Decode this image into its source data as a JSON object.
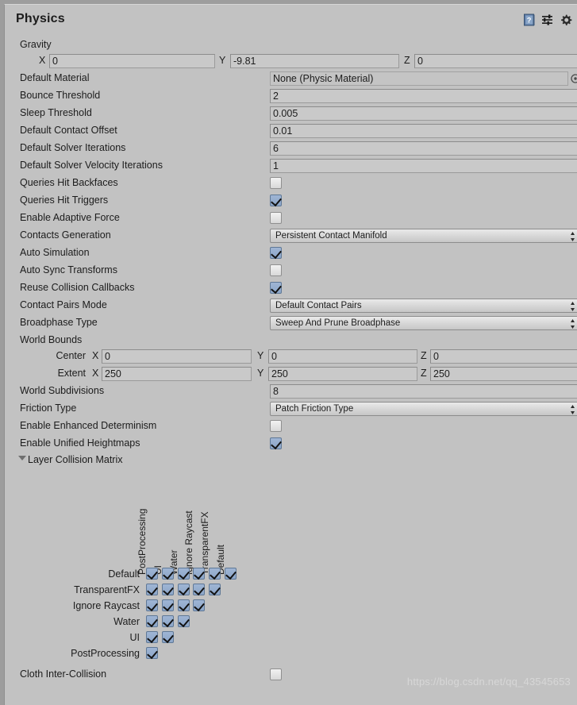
{
  "window": {
    "title": "Physics",
    "header_icons": [
      {
        "name": "help-icon",
        "glyph": "?"
      },
      {
        "name": "preset-icon",
        "glyph": "preset"
      },
      {
        "name": "settings-gear-icon",
        "glyph": "gear"
      }
    ]
  },
  "colors": {
    "panel_background": "#c2c2c2",
    "page_background": "#9d9d9d",
    "field_background": "#c9c9c9",
    "checkbox_checked": "#8ca6c9",
    "text": "#1c1c1c",
    "watermark": "#d9d9d9"
  },
  "properties": {
    "gravity": {
      "label": "Gravity",
      "x_axis_label": "X",
      "x_value": "0",
      "y_axis_label": "Y",
      "y_value": "-9.81",
      "z_axis_label": "Z",
      "z_value": "0"
    },
    "default_material": {
      "label": "Default Material",
      "value": "None (Physic Material)"
    },
    "bounce_threshold": {
      "label": "Bounce Threshold",
      "value": "2"
    },
    "sleep_threshold": {
      "label": "Sleep Threshold",
      "value": "0.005"
    },
    "default_contact_offset": {
      "label": "Default Contact Offset",
      "value": "0.01"
    },
    "default_solver_iterations": {
      "label": "Default Solver Iterations",
      "value": "6"
    },
    "default_solver_velocity_iterations": {
      "label": "Default Solver Velocity Iterations",
      "value": "1"
    },
    "queries_hit_backfaces": {
      "label": "Queries Hit Backfaces",
      "checked": false
    },
    "queries_hit_triggers": {
      "label": "Queries Hit Triggers",
      "checked": true
    },
    "enable_adaptive_force": {
      "label": "Enable Adaptive Force",
      "checked": false
    },
    "contacts_generation": {
      "label": "Contacts Generation",
      "value": "Persistent Contact Manifold"
    },
    "auto_simulation": {
      "label": "Auto Simulation",
      "checked": true
    },
    "auto_sync_transforms": {
      "label": "Auto Sync Transforms",
      "checked": false
    },
    "reuse_collision_callbacks": {
      "label": "Reuse Collision Callbacks",
      "checked": true
    },
    "contact_pairs_mode": {
      "label": "Contact Pairs Mode",
      "value": "Default Contact Pairs"
    },
    "broadphase_type": {
      "label": "Broadphase Type",
      "value": "Sweep And Prune Broadphase"
    },
    "world_bounds": {
      "label": "World Bounds",
      "center": {
        "label": "Center",
        "x_axis_label": "X",
        "x_value": "0",
        "y_axis_label": "Y",
        "y_value": "0",
        "z_axis_label": "Z",
        "z_value": "0"
      },
      "extent": {
        "label": "Extent",
        "x_axis_label": "X",
        "x_value": "250",
        "y_axis_label": "Y",
        "y_value": "250",
        "z_axis_label": "Z",
        "z_value": "250"
      }
    },
    "world_subdivisions": {
      "label": "World Subdivisions",
      "value": "8"
    },
    "friction_type": {
      "label": "Friction Type",
      "value": "Patch Friction Type"
    },
    "enable_enhanced_determinism": {
      "label": "Enable Enhanced Determinism",
      "checked": false
    },
    "enable_unified_heightmaps": {
      "label": "Enable Unified Heightmaps",
      "checked": true
    },
    "cloth_inter_collision": {
      "label": "Cloth Inter-Collision",
      "checked": false
    }
  },
  "layer_collision_matrix": {
    "label": "Layer Collision Matrix",
    "expanded": true,
    "column_labels": [
      "PostProcessing",
      "UI",
      "Water",
      "Ignore Raycast",
      "TransparentFX",
      "Default"
    ],
    "row_labels": [
      "Default",
      "TransparentFX",
      "Ignore Raycast",
      "Water",
      "UI",
      "PostProcessing"
    ],
    "rows": [
      {
        "label": "Default",
        "values": [
          true,
          true,
          true,
          true,
          true,
          true
        ]
      },
      {
        "label": "TransparentFX",
        "values": [
          true,
          true,
          true,
          true,
          true
        ]
      },
      {
        "label": "Ignore Raycast",
        "values": [
          true,
          true,
          true,
          true
        ]
      },
      {
        "label": "Water",
        "values": [
          true,
          true,
          true
        ]
      },
      {
        "label": "UI",
        "values": [
          true,
          true
        ]
      },
      {
        "label": "PostProcessing",
        "values": [
          true
        ]
      }
    ]
  },
  "watermark": {
    "text": "https://blog.csdn.net/qq_43545653"
  }
}
